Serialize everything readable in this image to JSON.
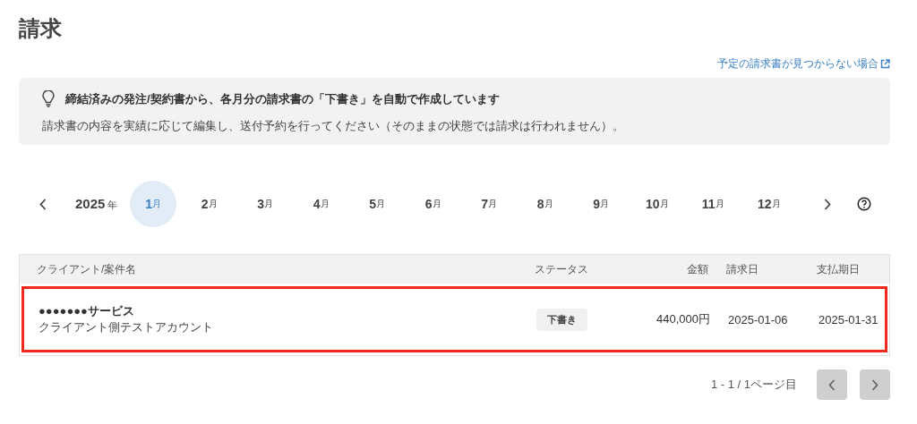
{
  "title": "請求",
  "help_link": "予定の請求書が見つからない場合",
  "notice": {
    "heading": "締結済みの発注/契約書から、各月分の請求書の「下書き」を自動で作成しています",
    "body": "請求書の内容を実績に応じて編集し、送付予約を行ってください（そのままの状態では請求は行われません）。"
  },
  "calendar": {
    "year": "2025",
    "year_unit": "年",
    "months": [
      {
        "number": "1",
        "unit": "月",
        "selected": true
      },
      {
        "number": "2",
        "unit": "月",
        "selected": false
      },
      {
        "number": "3",
        "unit": "月",
        "selected": false
      },
      {
        "number": "4",
        "unit": "月",
        "selected": false
      },
      {
        "number": "5",
        "unit": "月",
        "selected": false
      },
      {
        "number": "6",
        "unit": "月",
        "selected": false
      },
      {
        "number": "7",
        "unit": "月",
        "selected": false
      },
      {
        "number": "8",
        "unit": "月",
        "selected": false
      },
      {
        "number": "9",
        "unit": "月",
        "selected": false
      },
      {
        "number": "10",
        "unit": "月",
        "selected": false
      },
      {
        "number": "11",
        "unit": "月",
        "selected": false
      },
      {
        "number": "12",
        "unit": "月",
        "selected": false
      }
    ]
  },
  "table": {
    "columns": [
      "クライアント/案件名",
      "ステータス",
      "金額",
      "請求日",
      "支払期日"
    ],
    "rows": [
      {
        "client": "●●●●●●●サービス",
        "project": "クライアント側テストアカウント",
        "status": "下書き",
        "amount": "440,000円",
        "invoice_date": "2025-01-06",
        "due_date": "2025-01-31",
        "highlighted": true
      }
    ]
  },
  "pagination": {
    "summary": "1 - 1 / 1ページ目",
    "prev_disabled": true,
    "next_disabled": true
  }
}
